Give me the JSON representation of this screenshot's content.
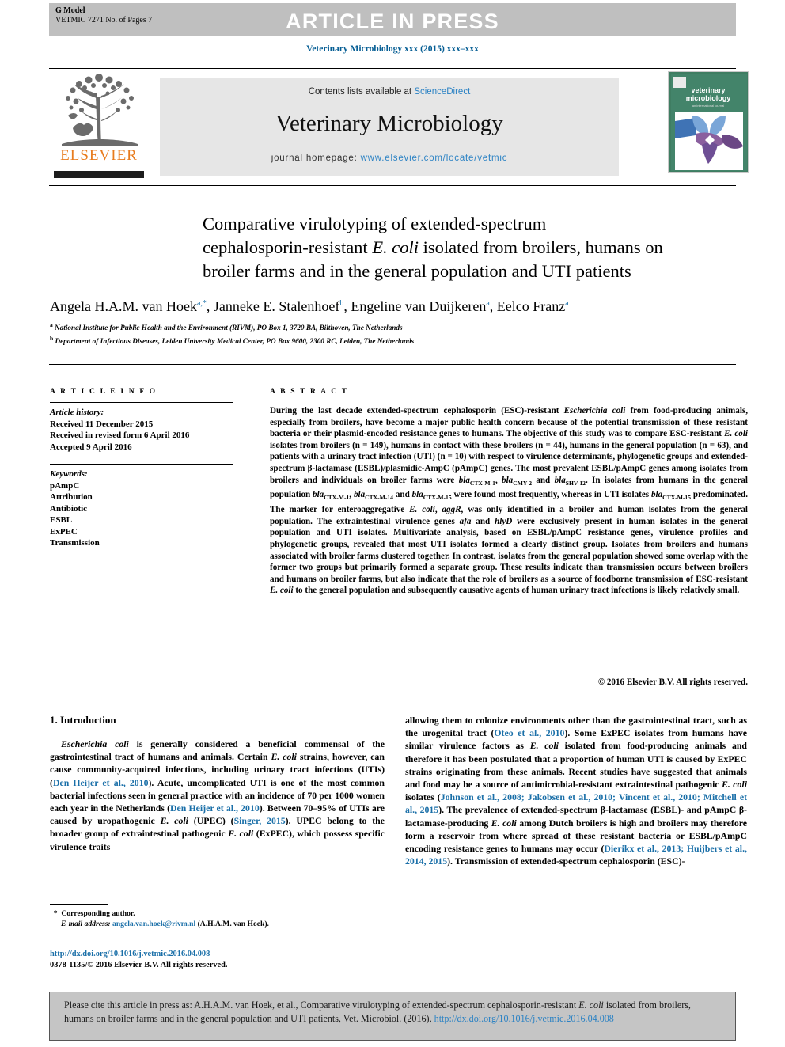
{
  "banner": {
    "gmodel_label": "G Model",
    "gmodel_ref": "VETMIC 7271 No. of Pages 7",
    "press_title": "ARTICLE IN PRESS"
  },
  "journal_line": "Veterinary Microbiology xxx (2015) xxx–xxx",
  "masthead": {
    "contents_prefix": "Contents lists available at ",
    "contents_link": "ScienceDirect",
    "journal_name": "Veterinary Microbiology",
    "homepage_prefix": "journal homepage: ",
    "homepage_link": "www.elsevier.com/locate/vetmic",
    "publisher_wordmark": "ELSEVIER",
    "cover_title_line1": "veterinary",
    "cover_title_line2": "microbiology"
  },
  "article": {
    "title_line1": "Comparative virulotyping of extended-spectrum",
    "title_line2_a": "cephalosporin-resistant ",
    "title_line2_italic": "E. coli",
    "title_line2_b": " isolated from broilers, humans on",
    "title_line3": "broiler farms and in the general population and UTI patients",
    "authors": "Angela H.A.M. van Hoek, Janneke E. Stalenhoef, Engeline van Duijkeren, Eelco Franz",
    "affiliation_a": "National Institute for Public Health and the Environment (RIVM), PO Box 1, 3720 BA, Bilthoven, The Netherlands",
    "affiliation_b": "Department of Infectious Diseases, Leiden University Medical Center, PO Box 9600, 2300 RC, Leiden, The Netherlands"
  },
  "info": {
    "heading": "A R T I C L E   I N F O",
    "history_label": "Article history:",
    "history": [
      "Received 11 December 2015",
      "Received in revised form 6 April 2016",
      "Accepted 9 April 2016"
    ],
    "keywords_label": "Keywords:",
    "keywords": [
      "pAmpC",
      "Attribution",
      "Antibiotic",
      "ESBL",
      "ExPEC",
      "Transmission"
    ]
  },
  "abstract": {
    "heading": "A B S T R A C T",
    "copyright": "© 2016 Elsevier B.V. All rights reserved."
  },
  "body": {
    "section1_heading": "1. Introduction"
  },
  "footnote": {
    "corresponding": "Corresponding author.",
    "email_label": "E-mail address:",
    "email": "angela.van.hoek@rivm.nl",
    "email_suffix": "(A.H.A.M.  van Hoek)."
  },
  "doi_block": {
    "doi_url": "http://dx.doi.org/10.1016/j.vetmic.2016.04.008",
    "issn_line": "0378-1135/© 2016 Elsevier B.V. All rights reserved."
  },
  "cite_box": {
    "text_a": "Please cite this article in press as: A.H.A.M. van Hoek, et al., Comparative virulotyping of extended-spectrum cephalosporin-resistant ",
    "text_italic": "E. coli",
    "text_b": " isolated from broilers, humans on broiler farms and in the general population and UTI patients, Vet. Microbiol. (2016), ",
    "link": "http://dx.doi.org/10.1016/j.vetmic.2016.04.008"
  },
  "colors": {
    "link_blue": "#2b82c4",
    "reference_blue": "#1a6fa8",
    "banner_gray": "#bfbfbf",
    "elsevier_orange": "#e87c1e",
    "cite_box_gray": "#c5c5c5"
  }
}
